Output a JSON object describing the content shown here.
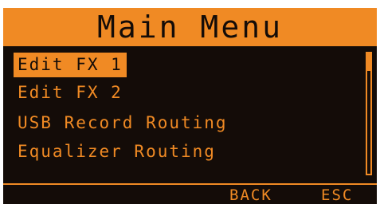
{
  "screen": {
    "title": "Main Menu"
  },
  "menu": {
    "items": [
      {
        "label": "Edit FX 1",
        "selected": true
      },
      {
        "label": "Edit FX 2",
        "selected": false
      },
      {
        "label": "USB Record Routing",
        "selected": false
      },
      {
        "label": "Equalizer Routing",
        "selected": false
      }
    ]
  },
  "softkeys": {
    "back_label": "BACK",
    "esc_label": "ESC"
  },
  "colors": {
    "accent": "#f08a24",
    "background": "#140c08"
  }
}
